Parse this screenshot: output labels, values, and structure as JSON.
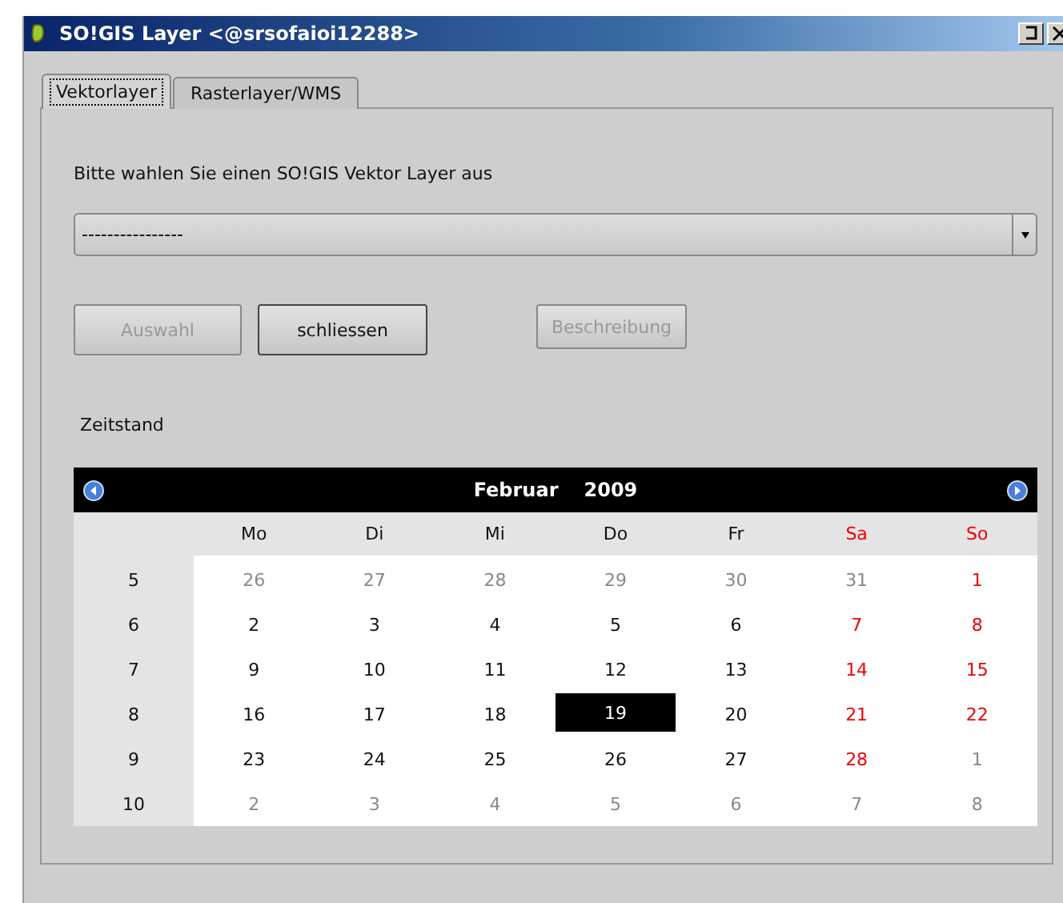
{
  "window": {
    "title": "SO!GIS Layer <@srsofaioi12288>"
  },
  "tabs": [
    {
      "label": "Vektorlayer",
      "selected": true
    },
    {
      "label": "Rasterlayer/WMS",
      "selected": false
    }
  ],
  "prompt": "Bitte wahlen Sie einen SO!GIS Vektor Layer aus",
  "layer_select": {
    "value": "----------------"
  },
  "buttons": [
    {
      "label": "Auswahl",
      "disabled": true
    },
    {
      "label": "schliessen",
      "disabled": false
    },
    {
      "label": "Beschreibung",
      "disabled": true
    }
  ],
  "date_label": "Zeitstand",
  "calendar": {
    "month": "Februar",
    "year": "2009",
    "day_names": [
      {
        "text": "Mo",
        "weekend": false
      },
      {
        "text": "Di",
        "weekend": false
      },
      {
        "text": "Mi",
        "weekend": false
      },
      {
        "text": "Do",
        "weekend": false
      },
      {
        "text": "Fr",
        "weekend": false
      },
      {
        "text": "Sa",
        "weekend": true
      },
      {
        "text": "So",
        "weekend": true
      }
    ],
    "weeks": [
      {
        "week": "5",
        "days": [
          {
            "text": "26",
            "kind": "other",
            "selected": false
          },
          {
            "text": "27",
            "kind": "other",
            "selected": false
          },
          {
            "text": "28",
            "kind": "other",
            "selected": false
          },
          {
            "text": "29",
            "kind": "other",
            "selected": false
          },
          {
            "text": "30",
            "kind": "other",
            "selected": false
          },
          {
            "text": "31",
            "kind": "other",
            "selected": false
          },
          {
            "text": "1",
            "kind": "current",
            "weekend": true,
            "selected": false
          }
        ]
      },
      {
        "week": "6",
        "days": [
          {
            "text": "2",
            "kind": "current",
            "weekend": false,
            "selected": false
          },
          {
            "text": "3",
            "kind": "current",
            "weekend": false,
            "selected": false
          },
          {
            "text": "4",
            "kind": "current",
            "weekend": false,
            "selected": false
          },
          {
            "text": "5",
            "kind": "current",
            "weekend": false,
            "selected": false
          },
          {
            "text": "6",
            "kind": "current",
            "weekend": false,
            "selected": false
          },
          {
            "text": "7",
            "kind": "current",
            "weekend": true,
            "selected": false
          },
          {
            "text": "8",
            "kind": "current",
            "weekend": true,
            "selected": false
          }
        ]
      },
      {
        "week": "7",
        "days": [
          {
            "text": "9",
            "kind": "current",
            "weekend": false,
            "selected": false
          },
          {
            "text": "10",
            "kind": "current",
            "weekend": false,
            "selected": false
          },
          {
            "text": "11",
            "kind": "current",
            "weekend": false,
            "selected": false
          },
          {
            "text": "12",
            "kind": "current",
            "weekend": false,
            "selected": false
          },
          {
            "text": "13",
            "kind": "current",
            "weekend": false,
            "selected": false
          },
          {
            "text": "14",
            "kind": "current",
            "weekend": true,
            "selected": false
          },
          {
            "text": "15",
            "kind": "current",
            "weekend": true,
            "selected": false
          }
        ]
      },
      {
        "week": "8",
        "days": [
          {
            "text": "16",
            "kind": "current",
            "weekend": false,
            "selected": false
          },
          {
            "text": "17",
            "kind": "current",
            "weekend": false,
            "selected": false
          },
          {
            "text": "18",
            "kind": "current",
            "weekend": false,
            "selected": false
          },
          {
            "text": "19",
            "kind": "current",
            "weekend": false,
            "selected": true
          },
          {
            "text": "20",
            "kind": "current",
            "weekend": false,
            "selected": false
          },
          {
            "text": "21",
            "kind": "current",
            "weekend": true,
            "selected": false
          },
          {
            "text": "22",
            "kind": "current",
            "weekend": true,
            "selected": false
          }
        ]
      },
      {
        "week": "9",
        "days": [
          {
            "text": "23",
            "kind": "current",
            "weekend": false,
            "selected": false
          },
          {
            "text": "24",
            "kind": "current",
            "weekend": false,
            "selected": false
          },
          {
            "text": "25",
            "kind": "current",
            "weekend": false,
            "selected": false
          },
          {
            "text": "26",
            "kind": "current",
            "weekend": false,
            "selected": false
          },
          {
            "text": "27",
            "kind": "current",
            "weekend": false,
            "selected": false
          },
          {
            "text": "28",
            "kind": "current",
            "weekend": true,
            "selected": false
          },
          {
            "text": "1",
            "kind": "other",
            "selected": false
          }
        ]
      },
      {
        "week": "10",
        "days": [
          {
            "text": "2",
            "kind": "other",
            "selected": false
          },
          {
            "text": "3",
            "kind": "other",
            "selected": false
          },
          {
            "text": "4",
            "kind": "other",
            "selected": false
          },
          {
            "text": "5",
            "kind": "other",
            "selected": false
          },
          {
            "text": "6",
            "kind": "other",
            "selected": false
          },
          {
            "text": "7",
            "kind": "other",
            "selected": false
          },
          {
            "text": "8",
            "kind": "other",
            "selected": false
          }
        ]
      }
    ]
  }
}
